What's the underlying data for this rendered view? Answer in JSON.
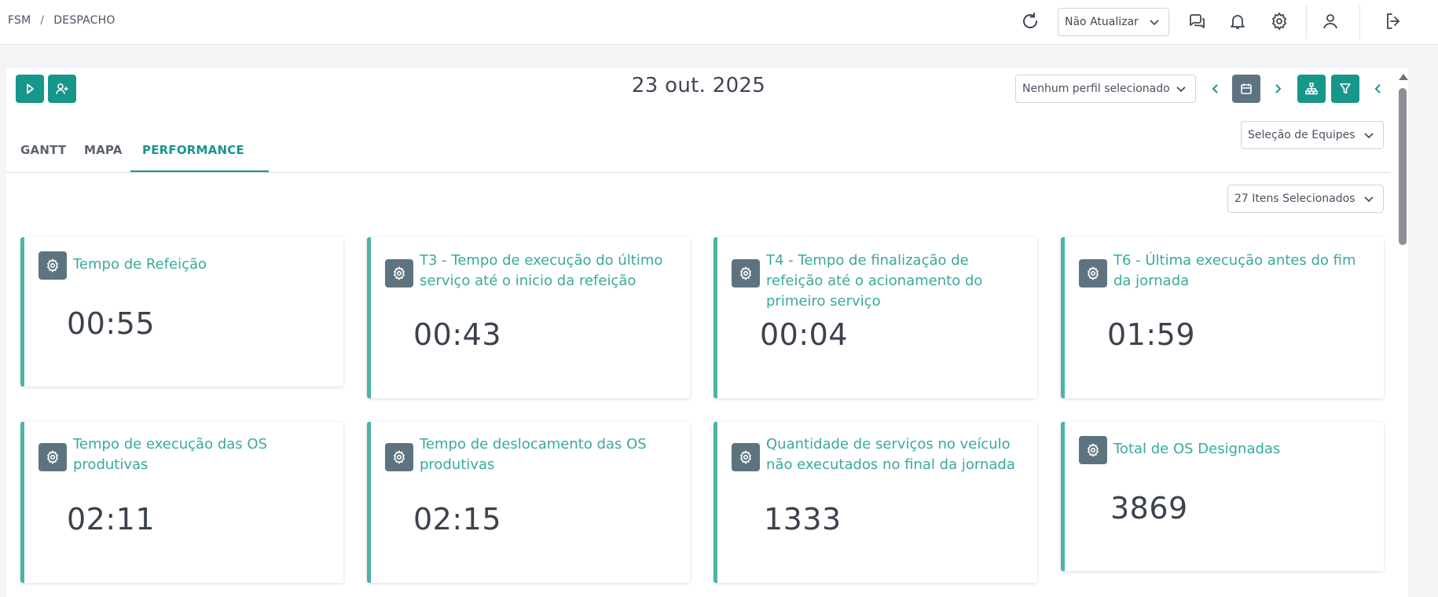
{
  "breadcrumb": {
    "root": "FSM",
    "separator": "/",
    "current": "DESPACHO"
  },
  "topbar": {
    "refresh_select_value": "Não Atualizar",
    "icons": [
      "refresh-icon",
      "chat-icon",
      "bell-icon",
      "gear-icon",
      "user-icon",
      "logout-icon"
    ]
  },
  "toolbar": {
    "date": "23 out. 2025",
    "profile_select": "Nenhum perfil selecionado",
    "teams_select": "Seleção de Equipes",
    "items_select": "27 Itens Selecionados"
  },
  "tabs": [
    {
      "label": "GANTT",
      "active": false
    },
    {
      "label": "MAPA",
      "active": false
    },
    {
      "label": "PERFORMANCE",
      "active": true
    }
  ],
  "cards": [
    {
      "title": "Tempo de Refeição",
      "value": "00:55"
    },
    {
      "title": "T3 - Tempo de execução do último serviço até o inicio da refeição",
      "value": "00:43"
    },
    {
      "title": "T4 - Tempo de finalização de refeição até o acionamento do primeiro serviço",
      "value": "00:04"
    },
    {
      "title": "T6 - Última execução antes do fim da jornada",
      "value": "01:59"
    },
    {
      "title": "Tempo de execução das OS produtivas",
      "value": "02:11"
    },
    {
      "title": "Tempo de deslocamento das OS produtivas",
      "value": "02:15"
    },
    {
      "title": "Quantidade de serviços no veículo não executados no final da jornada",
      "value": "1333"
    },
    {
      "title": "Total de OS Designadas",
      "value": "3869"
    }
  ],
  "colors": {
    "accent": "#17968a",
    "card_border": "#4bb3a8",
    "card_title": "#3aa99d",
    "icon_box": "#5e7380"
  }
}
